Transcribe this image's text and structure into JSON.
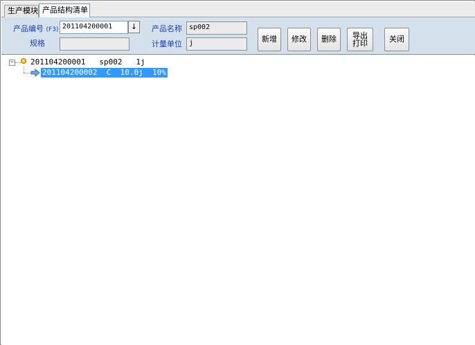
{
  "tabs": [
    {
      "label": "生产模块"
    },
    {
      "label": "产品结构清单"
    }
  ],
  "form": {
    "product_code_label": "产品编号",
    "product_code_hint": "(F3)",
    "product_code_value": "201104200001",
    "dropdown_glyph": "↓",
    "product_name_label": "产品名称",
    "product_name_value": "sp002",
    "spec_label": "规格",
    "spec_value": "",
    "unit_label": "计量单位",
    "unit_value": "j"
  },
  "toolbar": {
    "add_label": "新增",
    "edit_label": "修改",
    "delete_label": "删除",
    "export_line1": "导出",
    "export_line2": "打印",
    "close_label": "关闭"
  },
  "tree": {
    "expander_glyph": "−",
    "root": "201104200001   sp002   1j",
    "child": "201104200002  C  10.0j  10%"
  },
  "colors": {
    "panel_bg": "#d4e1ec",
    "label_blue": "#1a3fb4",
    "selection": "#3399ff"
  }
}
